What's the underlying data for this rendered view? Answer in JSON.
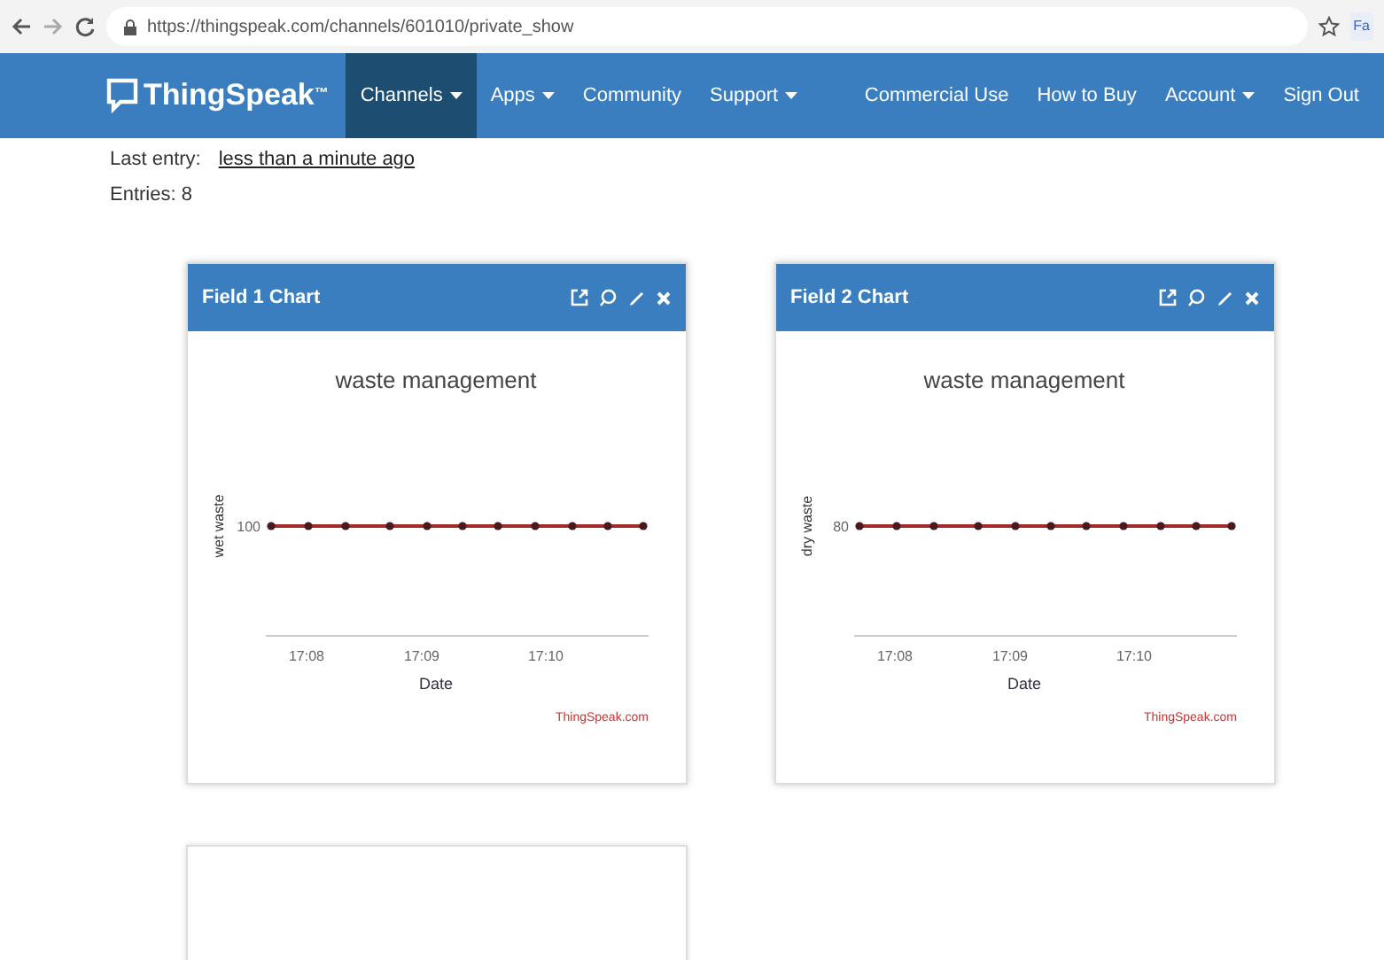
{
  "browser": {
    "url": "https://thingspeak.com/channels/601010/private_show",
    "extension_label": "Fa"
  },
  "navbar": {
    "brand": "ThingSpeak$^{™}$",
    "left_items": [
      {
        "label": "Channels",
        "dropdown": true,
        "selected": true
      },
      {
        "label": "Apps",
        "dropdown": true,
        "selected": false
      },
      {
        "label": "Community",
        "dropdown": false,
        "selected": false
      },
      {
        "label": "Support",
        "dropdown": true,
        "selected": false
      }
    ],
    "right_items": [
      {
        "label": "Commercial Use",
        "dropdown": false,
        "selected": false
      },
      {
        "label": "How to Buy",
        "dropdown": false,
        "selected": false
      },
      {
        "label": "Account",
        "dropdown": true,
        "selected": false
      },
      {
        "label": "Sign Out",
        "dropdown": false,
        "selected": false
      }
    ]
  },
  "channel_info": {
    "last_entry_label": "Last entry:",
    "last_entry_value": "less than a minute ago",
    "entries": "Entries: 8"
  },
  "charts": [
    {
      "title": "Field 1 Chart",
      "credit": "ThingSpeak.com",
      "plot": {
        "title": "waste management",
        "xlabel": "Date",
        "ylabel": "wet waste",
        "y_tick_label": "100",
        "x_tick_labels": [
          "17:08",
          "17:09",
          "17:10"
        ]
      }
    },
    {
      "title": "Field 2 Chart",
      "credit": "ThingSpeak.com",
      "plot": {
        "title": "waste management",
        "xlabel": "Date",
        "ylabel": "dry waste",
        "y_tick_label": "80",
        "x_tick_labels": [
          "17:08",
          "17:09",
          "17:10"
        ]
      }
    }
  ]
}
